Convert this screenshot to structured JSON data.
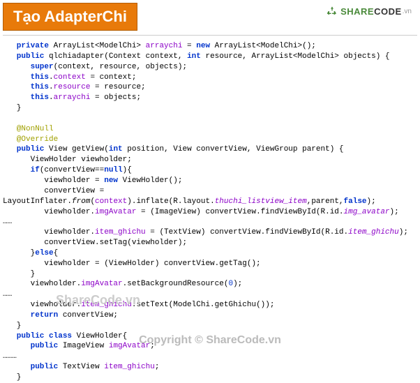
{
  "header": {
    "title": "Tạo AdapterChi"
  },
  "logo": {
    "share": "SHARE",
    "code": "CODE",
    "vn": ".vn"
  },
  "code": {
    "l1a": "   private",
    "l1b": " ArrayList<ModelChi> ",
    "l1c": "arraychi",
    "l1d": " = ",
    "l1e": "new",
    "l1f": " ArrayList<ModelChi>();",
    "l2a": "   public",
    "l2b": " qlchiadapter(Context context, ",
    "l2c": "int",
    "l2d": " resource, ArrayList<ModelChi> objects) {",
    "l3a": "      super",
    "l3b": "(context, resource, objects);",
    "l4a": "      this",
    "l4b": ".",
    "l4c": "context",
    "l4d": " = context;",
    "l5a": "      this",
    "l5b": ".",
    "l5c": "resource",
    "l5d": " = resource;",
    "l6a": "      this",
    "l6b": ".",
    "l6c": "arraychi",
    "l6d": " = objects;",
    "l7": "   }",
    "l8": "",
    "l9a": "   @NonNull",
    "l10a": "   @Override",
    "l11a": "   public",
    "l11b": " View getView(",
    "l11c": "int",
    "l11d": " position, View convertView, ViewGroup parent) {",
    "l12": "      ViewHolder viewholder;",
    "l13a": "      if",
    "l13b": "(convertView==",
    "l13c": "null",
    "l13d": "){",
    "l14a": "         viewholder = ",
    "l14b": "new",
    "l14c": " ViewHolder();",
    "l15": "         convertView =",
    "l16a": "LayoutInflater.",
    "l16b": "from",
    "l16c": "(",
    "l16d": "context",
    "l16e": ").inflate(R.layout.",
    "l16f": "thuchi_listview_item",
    "l16g": ",parent,",
    "l16h": "false",
    "l16i": ");",
    "l17a": "         viewholder.",
    "l17b": "imgAvatar",
    "l17c": " = (ImageView) convertView.findViewById(R.id.",
    "l17d": "img_avatar",
    "l17e": ");",
    "l18": "……",
    "l19a": "         viewholder.",
    "l19b": "item_ghichu",
    "l19c": " = (TextView) convertView.findViewById(R.id.",
    "l19d": "item_ghichu",
    "l19e": ");",
    "l20": "         convertView.setTag(viewholder);",
    "l21a": "      }",
    "l21b": "else",
    "l21c": "{",
    "l22": "         viewholder = (ViewHolder) convertView.getTag();",
    "l23": "      }",
    "l24a": "      viewholder.",
    "l24b": "imgAvatar",
    "l24c": ".setBackgroundResource(",
    "l24d": "0",
    "l24e": ");",
    "l25": "……",
    "l26a": "      viewholder.",
    "l26b": "item_ghichu",
    "l26c": ".setText(ModelChi.getGhichu());",
    "l27a": "      return",
    "l27b": " convertView;",
    "l28": "   }",
    "l29a": "   public class ",
    "l29b": "ViewHolder{",
    "l30a": "      public",
    "l30b": " ImageView ",
    "l30c": "imgAvatar",
    "l30d": ";",
    "l31": "………",
    "l32a": "      public",
    "l32b": " TextView ",
    "l32c": "item_ghichu",
    "l32d": ";",
    "l33": "   }"
  },
  "watermark": {
    "w1": "ShareCode.vn",
    "w2": "Copyright © ShareCode.vn"
  }
}
